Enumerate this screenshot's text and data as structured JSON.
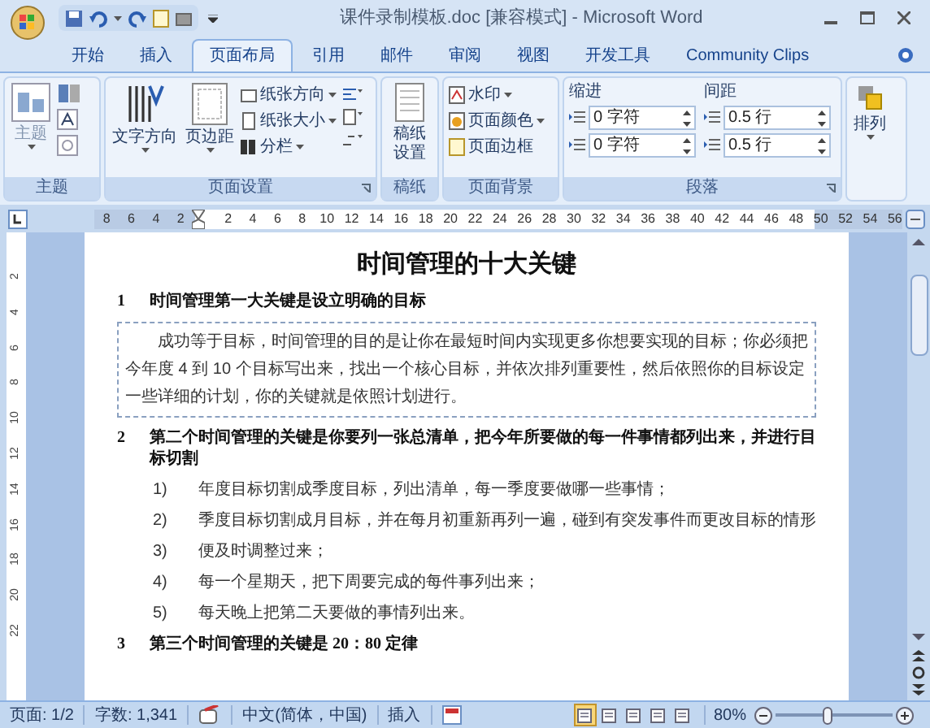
{
  "window": {
    "title": "课件录制模板.doc [兼容模式] - Microsoft Word"
  },
  "tabs": [
    {
      "label": "开始",
      "selected": false
    },
    {
      "label": "插入",
      "selected": false
    },
    {
      "label": "页面布局",
      "selected": true
    },
    {
      "label": "引用",
      "selected": false
    },
    {
      "label": "邮件",
      "selected": false
    },
    {
      "label": "审阅",
      "selected": false
    },
    {
      "label": "视图",
      "selected": false
    },
    {
      "label": "开发工具",
      "selected": false
    },
    {
      "label": "Community Clips",
      "selected": false
    }
  ],
  "ribbon": {
    "groups": [
      {
        "kind": "theme",
        "label": "主题",
        "big_buttons": [
          "主题"
        ]
      },
      {
        "kind": "page_setup",
        "label": "页面设置",
        "big_buttons": [
          "文字方向",
          "页边距"
        ],
        "small_buttons": [
          {
            "label": "纸张方向",
            "dropdown": true
          },
          {
            "label": "纸张大小",
            "dropdown": true
          },
          {
            "label": "分栏",
            "dropdown": true
          }
        ]
      },
      {
        "kind": "paper",
        "label": "稿纸",
        "big_buttons": [
          "稿纸设置"
        ]
      },
      {
        "kind": "background",
        "label": "页面背景",
        "small_buttons": [
          {
            "label": "水印",
            "dropdown": true
          },
          {
            "label": "页面颜色",
            "dropdown": true
          },
          {
            "label": "页面边框",
            "dropdown": false
          }
        ]
      },
      {
        "kind": "paragraph",
        "label": "段落",
        "indent": {
          "label": "缩进",
          "fields": [
            "0 字符",
            "0 字符"
          ]
        },
        "spacing": {
          "label": "间距",
          "fields": [
            "0.5 行",
            "0.5 行"
          ]
        }
      },
      {
        "kind": "arrange",
        "big_buttons": [
          "排列"
        ]
      }
    ]
  },
  "ruler": {
    "horizontal": [
      "8",
      "6",
      "4",
      "2",
      "2",
      "4",
      "6",
      "8",
      "10",
      "12",
      "14",
      "16",
      "18",
      "20",
      "22",
      "24",
      "26",
      "28",
      "30",
      "32",
      "34",
      "36",
      "38",
      "40",
      "42",
      "44",
      "46",
      "48",
      "50",
      "52",
      "54",
      "56"
    ],
    "vertical": [
      "2",
      "4",
      "6",
      "8",
      "10",
      "12",
      "14",
      "16",
      "18",
      "20",
      "22"
    ]
  },
  "document": {
    "title": "时间管理的十大关键",
    "blocks": [
      {
        "kind": "heading",
        "number": "1",
        "text": "时间管理第一大关键是设立明确的目标"
      },
      {
        "kind": "paragraph",
        "text": "成功等于目标，时间管理的目的是让你在最短时间内实现更多你想要实现的目标；你必须把今年度 4 到 10 个目标写出来，找出一个核心目标，并依次排列重要性，然后依照你的目标设定一些详细的计划，你的关键就是依照计划进行。"
      },
      {
        "kind": "heading",
        "number": "2",
        "text": "第二个时间管理的关键是你要列一张总清单，把今年所要做的每一件事情都列出来，并进行目标切割"
      },
      {
        "kind": "list_item",
        "number": "1)",
        "text": "年度目标切割成季度目标，列出清单，每一季度要做哪一些事情；"
      },
      {
        "kind": "list_item",
        "number": "2)",
        "text": "季度目标切割成月目标，并在每月初重新再列一遍，碰到有突发事件而更改目标的情形"
      },
      {
        "kind": "list_item",
        "number": "3)",
        "text": "便及时调整过来；"
      },
      {
        "kind": "list_item",
        "number": "4)",
        "text": "每一个星期天，把下周要完成的每件事列出来；"
      },
      {
        "kind": "list_item",
        "number": "5)",
        "text": "每天晚上把第二天要做的事情列出来。"
      },
      {
        "kind": "heading",
        "number": "3",
        "text": "第三个时间管理的关键是 20：80 定律"
      }
    ]
  },
  "status_bar": {
    "page": "页面: 1/2",
    "words": "字数: 1,341",
    "language": "中文(简体，中国)",
    "mode": "插入",
    "views": [
      {
        "selected": true
      },
      {
        "selected": false
      },
      {
        "selected": false
      },
      {
        "selected": false
      },
      {
        "selected": false
      }
    ],
    "zoom": {
      "label": "80%",
      "level": 0.45
    }
  }
}
